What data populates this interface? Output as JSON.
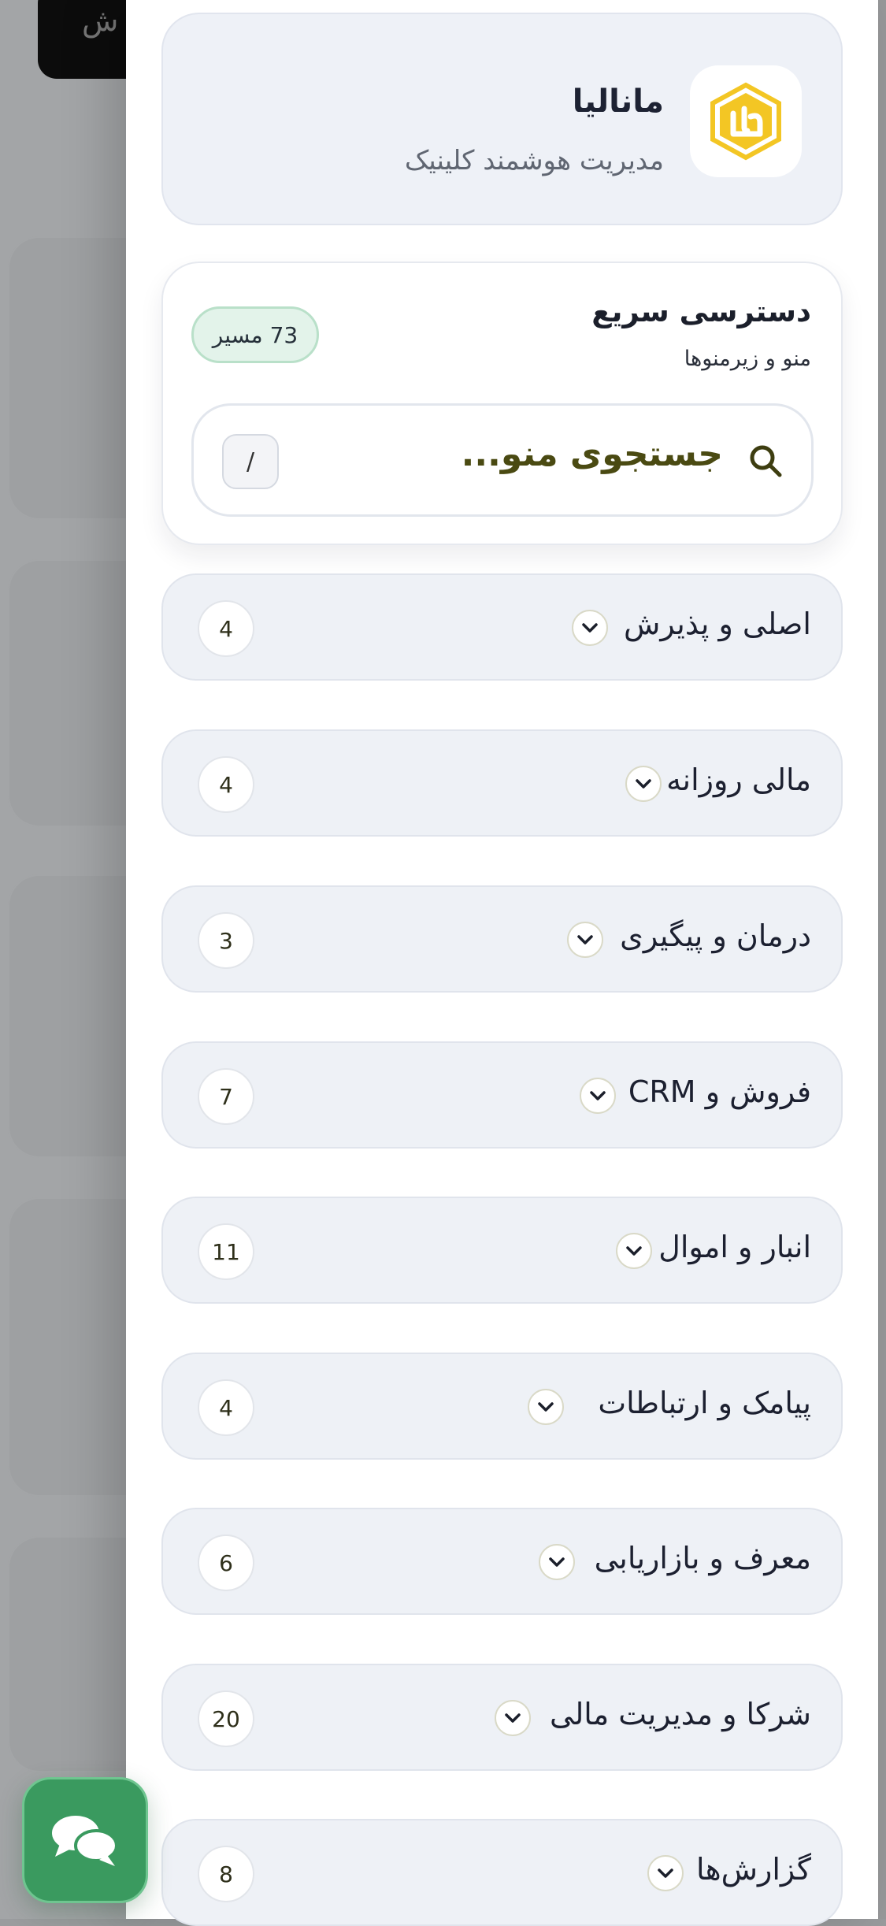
{
  "background": {
    "pill_text": "ش"
  },
  "brand": {
    "name": "مانالیا",
    "subtitle": "مدیریت هوشمند کلینیک",
    "logo_icon": "brand-logo-hexagon",
    "logo_color": "#f3c624"
  },
  "quick_access": {
    "title": "دسترسی سریع",
    "subtitle": "منو و زیرمنوها",
    "routes_badge": "73 مسیر",
    "search": {
      "placeholder": "جستجوی منو...",
      "icon": "search-icon",
      "shortcut_key": "/"
    }
  },
  "sections": [
    {
      "label": "اصلی و پذیرش",
      "count": "4"
    },
    {
      "label": "مالی روزانه",
      "count": "4"
    },
    {
      "label": "درمان و پیگیری",
      "count": "3"
    },
    {
      "label": "فروش و CRM",
      "count": "7"
    },
    {
      "label": "انبار و اموال",
      "count": "11"
    },
    {
      "label": "پیامک و ارتباطات",
      "count": "4"
    },
    {
      "label": "معرف و بازاریابی",
      "count": "6"
    },
    {
      "label": "شرکا و مدیریت مالی",
      "count": "20"
    },
    {
      "label": "گزارش‌ها",
      "count": "8"
    }
  ],
  "chat_button": {
    "icon": "chat-bubbles-icon",
    "color": "#3a9a5f"
  },
  "colors": {
    "accent_green": "#3a9a5f",
    "search_text": "#4a4a12",
    "card_bg": "#eef1f6"
  }
}
